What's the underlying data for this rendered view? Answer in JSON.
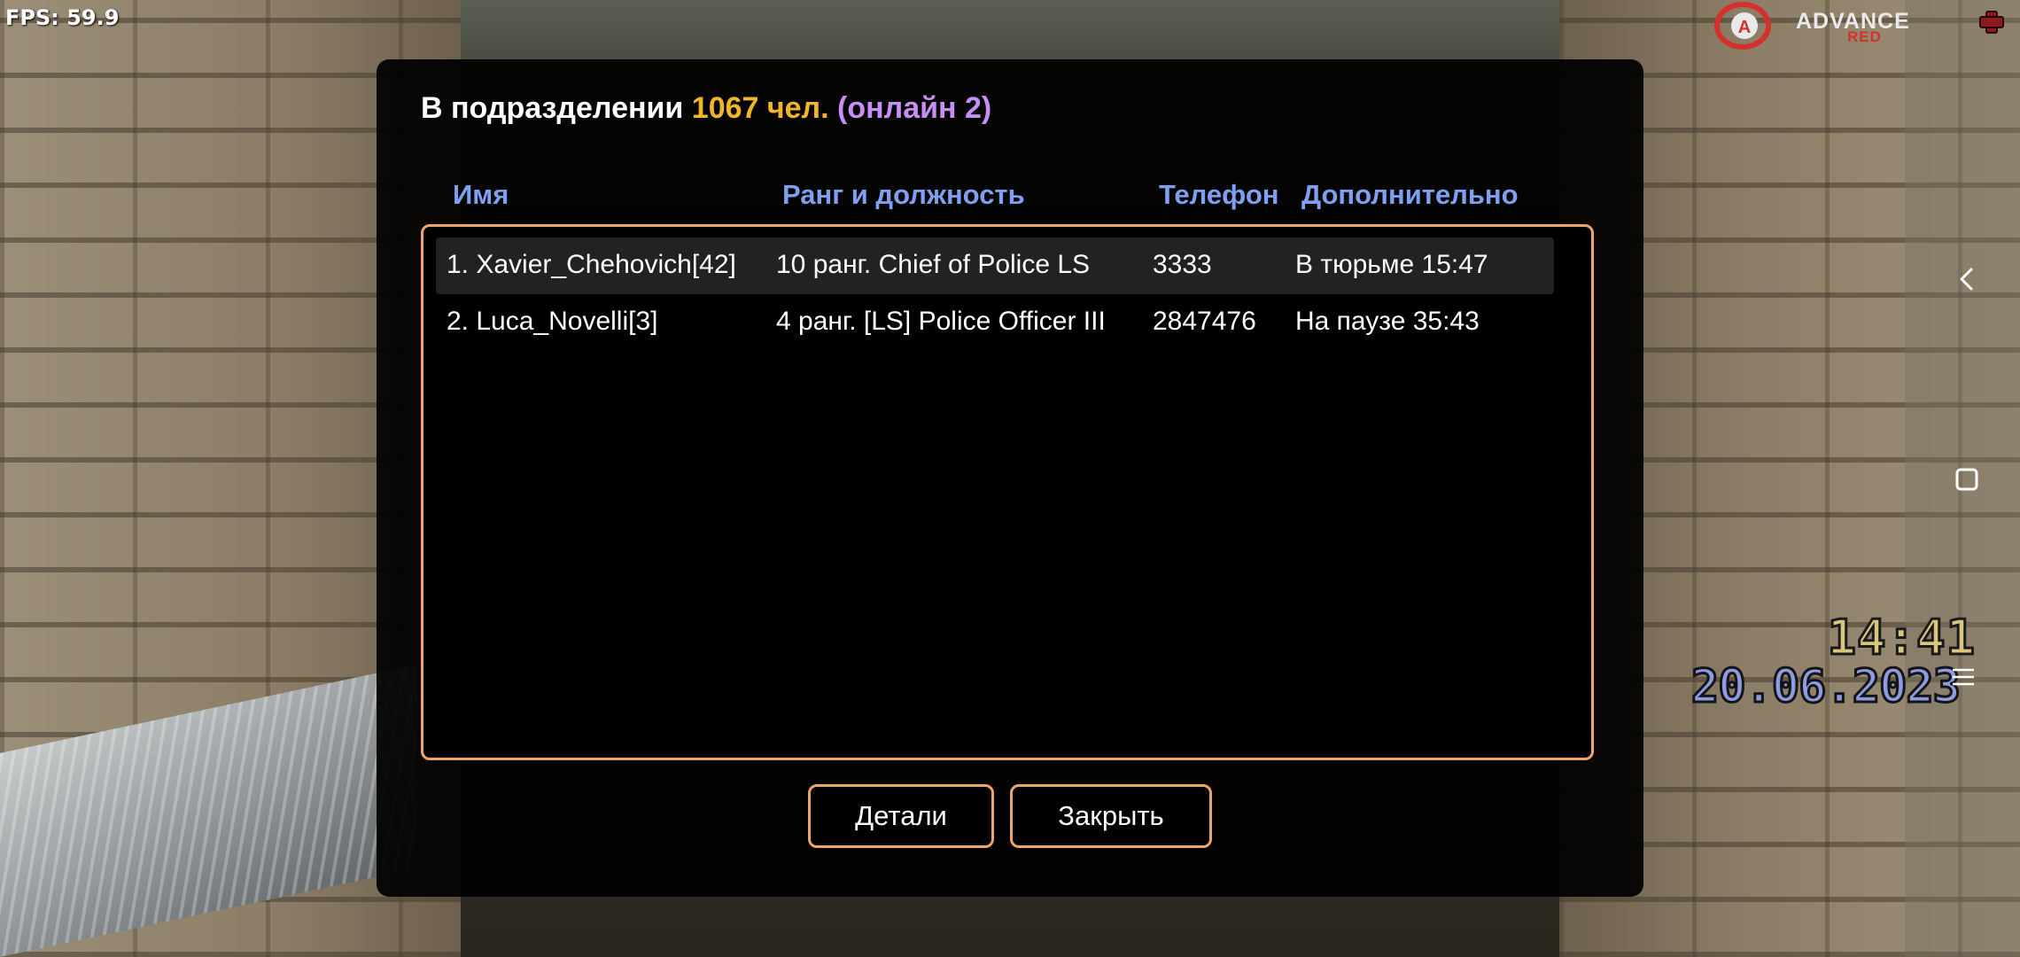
{
  "hud": {
    "fps_label": "FPS: 59.9",
    "brand_name": "ADVANCE",
    "brand_sub": "RED",
    "brand_logo_letter": "A",
    "game_time": "14:41",
    "game_date": "20.06.2023"
  },
  "dialog": {
    "title_prefix": "В подразделении ",
    "title_count": "1067 чел.",
    "title_online": " (онлайн 2)",
    "columns": {
      "name": "Имя",
      "rank": "Ранг и должность",
      "phone": "Телефон",
      "extra": "Дополнительно"
    },
    "members": [
      {
        "name": "1. Xavier_Chehovich[42]",
        "rank": "10 ранг. Chief of Police LS",
        "phone": "3333",
        "extra": "В тюрьме 15:47",
        "selected": true
      },
      {
        "name": "2. Luca_Novelli[3]",
        "rank": "4 ранг. [LS] Police Officer III",
        "phone": "2847476",
        "extra": "На паузе 35:43",
        "selected": false
      }
    ],
    "buttons": {
      "details": "Детали",
      "close": "Закрыть"
    }
  },
  "colors": {
    "accent_border": "#f0a46a",
    "header_text": "#7f9ff1",
    "count_text": "#f2b527",
    "online_text": "#c98ef3",
    "brand_red": "#d4312c"
  },
  "icons": {
    "brand_logo": "advance-rp-logo-icon",
    "health": "health-cross-icon",
    "back": "nav-back-icon",
    "home": "nav-home-icon",
    "menu": "menu-icon"
  }
}
